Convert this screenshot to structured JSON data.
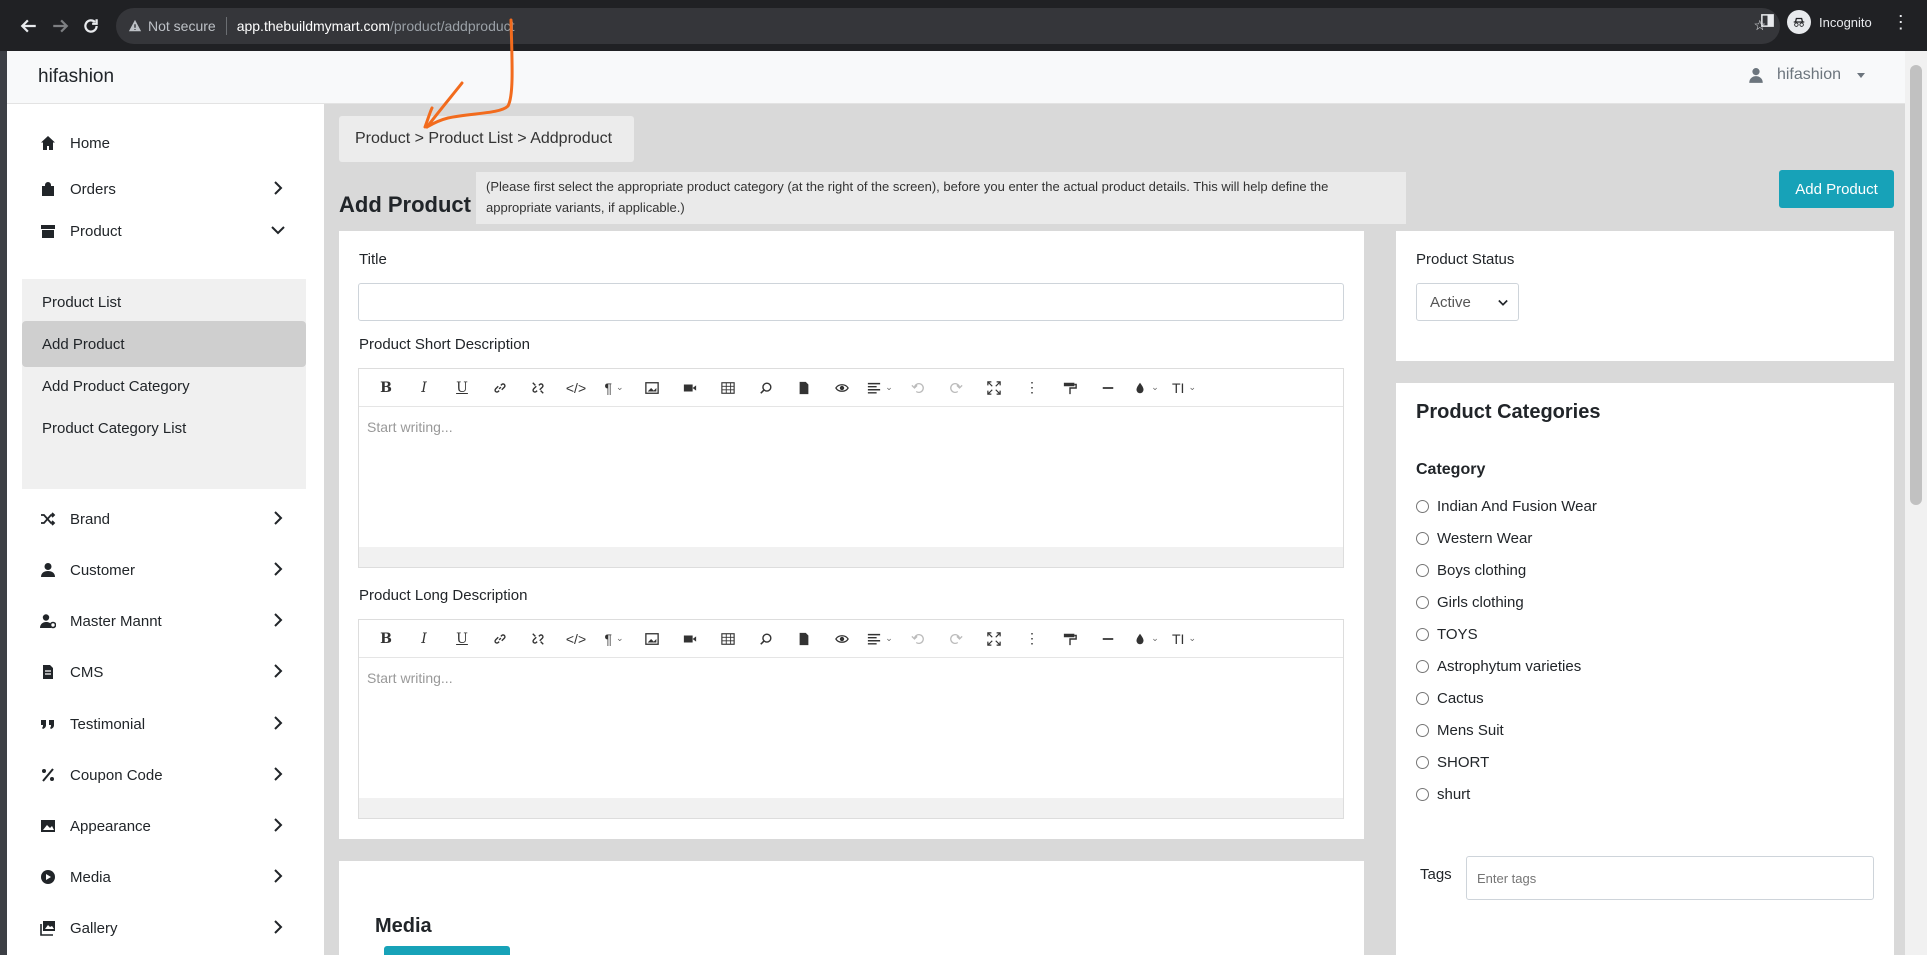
{
  "browser": {
    "security_label": "Not secure",
    "url_host": "app.thebuildmymart.com",
    "url_path": "/product/addproduct",
    "profile_label": "Incognito"
  },
  "app": {
    "brand": "hifashion",
    "user_name": "hifashion"
  },
  "sidebar": {
    "items": [
      {
        "label": "Home",
        "icon": "home-icon"
      },
      {
        "label": "Orders",
        "icon": "shopping-bag-icon"
      },
      {
        "label": "Product",
        "icon": "archive-icon"
      },
      {
        "label": "Brand",
        "icon": "shuffle-icon"
      },
      {
        "label": "Customer",
        "icon": "user-icon"
      },
      {
        "label": "Master Mannt",
        "icon": "user-gear-icon"
      },
      {
        "label": "CMS",
        "icon": "file-icon"
      },
      {
        "label": "Testimonial",
        "icon": "quote-icon"
      },
      {
        "label": "Coupon Code",
        "icon": "percent-icon"
      },
      {
        "label": "Appearance",
        "icon": "image-icon"
      },
      {
        "label": "Media",
        "icon": "play-circle-icon"
      },
      {
        "label": "Gallery",
        "icon": "images-icon"
      }
    ],
    "product_submenu": [
      "Product List",
      "Add Product",
      "Add Product Category",
      "Product Category List"
    ]
  },
  "main": {
    "breadcrumb": "Product > Product List > Addproduct",
    "page_title": "Add Product",
    "hint": "(Please first select the appropriate product category (at the right of the screen), before you enter the actual product details. This will help define the appropriate variants, if applicable.)",
    "add_button": "Add Product",
    "title_label": "Title",
    "title_value": "",
    "short_desc_label": "Product Short Description",
    "long_desc_label": "Product Long Description",
    "editor_placeholder": "Start writing...",
    "media_title": "Media"
  },
  "right": {
    "status_label": "Product Status",
    "status_value": "Active",
    "categories_title": "Product Categories",
    "category_label": "Category",
    "categories": [
      "Indian And Fusion Wear",
      "Western Wear",
      "Boys clothing",
      "Girls clothing",
      "TOYS",
      "Astrophytum varieties",
      "Cactus",
      "Mens Suit",
      "SHORT",
      "shurt"
    ],
    "tags_label": "Tags",
    "tags_placeholder": "Enter tags"
  },
  "colors": {
    "accent": "#17a2b8",
    "annotation": "#f26b1d"
  }
}
